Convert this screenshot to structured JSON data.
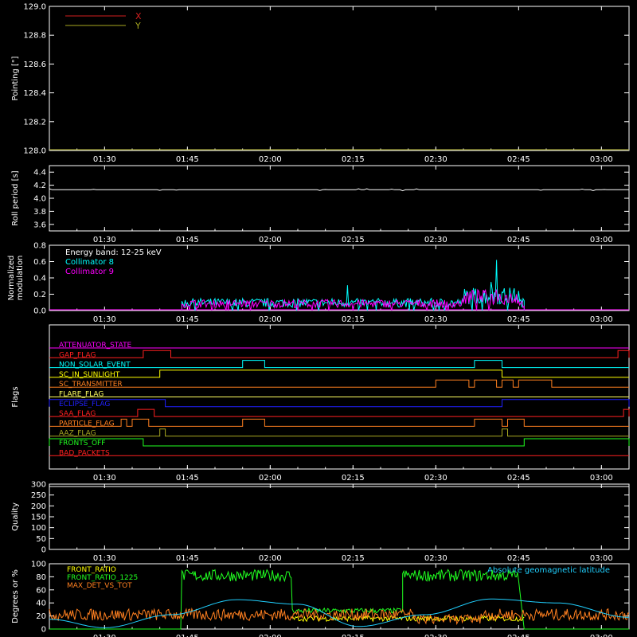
{
  "chart_data": [
    {
      "id": "pointing",
      "type": "line",
      "ylabel": "Pointing [\"]",
      "ylim": [
        128.0,
        129.0
      ],
      "yticks": [
        "128.0",
        "128.2",
        "128.4",
        "128.6",
        "128.8",
        "129.0"
      ],
      "xticks": [
        "01:30",
        "01:45",
        "02:00",
        "02:15",
        "02:30",
        "02:45",
        "03:00"
      ],
      "legend": [
        {
          "name": "X",
          "color": "#d42020"
        },
        {
          "name": "Y",
          "color": "#a8a820"
        }
      ],
      "series": []
    },
    {
      "id": "roll",
      "type": "line",
      "ylabel": "Roll period [s]",
      "ylim": [
        3.5,
        4.5
      ],
      "yticks": [
        "3.6",
        "3.8",
        "4.0",
        "4.2",
        "4.4"
      ],
      "xticks": [
        "01:30",
        "01:45",
        "02:00",
        "02:15",
        "02:30",
        "02:45",
        "03:00"
      ],
      "series": [
        {
          "color": "#ffffff",
          "x_range": [
            "01:20",
            "03:05"
          ],
          "value": 4.13
        }
      ]
    },
    {
      "id": "modulation",
      "type": "line",
      "ylabel": "Normalized modulation",
      "ylim": [
        0.0,
        0.8
      ],
      "yticks": [
        "0.0",
        "0.2",
        "0.4",
        "0.6",
        "0.8"
      ],
      "xticks": [
        "01:30",
        "01:45",
        "02:00",
        "02:15",
        "02:30",
        "02:45",
        "03:00"
      ],
      "annotations": [
        {
          "text": "Energy band: 12-25 keV",
          "color": "#ffffff"
        },
        {
          "text": "Collimator 8",
          "color": "#00ffff"
        },
        {
          "text": "Collimator 9",
          "color": "#ff00ff"
        }
      ],
      "series": [
        {
          "name": "Collimator 8",
          "color": "#00ffff",
          "x_range": [
            "01:44",
            "02:46"
          ],
          "typical": 0.1,
          "peaks": [
            [
              "02:14",
              0.31
            ],
            [
              "02:41",
              0.62
            ],
            [
              "02:40",
              0.35
            ]
          ]
        },
        {
          "name": "Collimator 9",
          "color": "#ff00ff",
          "x_range": [
            "01:44",
            "02:46"
          ],
          "typical": 0.09,
          "peaks": [
            [
              "02:41",
              0.25
            ]
          ]
        }
      ]
    },
    {
      "id": "flags",
      "type": "line",
      "ylabel": "Flags",
      "xticks": [
        "01:30",
        "01:45",
        "02:00",
        "02:15",
        "02:30",
        "02:45",
        "03:00"
      ],
      "flags": [
        {
          "name": "ATTENUATOR_STATE",
          "color": "#ff00ff",
          "segments": []
        },
        {
          "name": "GAP_FLAG",
          "color": "#ff2020",
          "segments": [
            [
              "01:37",
              "01:42"
            ],
            [
              "03:03",
              "03:05"
            ]
          ]
        },
        {
          "name": "NON_SOLAR_EVENT",
          "color": "#00ffff",
          "segments": [
            [
              "01:55",
              "01:59"
            ],
            [
              "02:37",
              "02:42"
            ]
          ]
        },
        {
          "name": "SC_IN_SUNLIGHT",
          "color": "#ffff00",
          "segments": [
            [
              "01:40",
              "02:42"
            ]
          ]
        },
        {
          "name": "SC_TRANSMITTER",
          "color": "#ff8020",
          "segments": [
            [
              "02:30",
              "02:36"
            ],
            [
              "02:37",
              "02:41"
            ],
            [
              "02:42",
              "02:44"
            ],
            [
              "02:45",
              "02:51"
            ]
          ]
        },
        {
          "name": "FLARE_FLAG",
          "color": "#ffff60",
          "segments": []
        },
        {
          "name": "ECLIPSE_FLAG",
          "color": "#2020ff",
          "segments": [
            [
              "01:20",
              "01:41"
            ],
            [
              "02:42",
              "03:05"
            ]
          ]
        },
        {
          "name": "SAA_FLAG",
          "color": "#ff2020",
          "segments": [
            [
              "01:36",
              "01:39"
            ],
            [
              "03:04",
              "03:05"
            ]
          ]
        },
        {
          "name": "PARTICLE_FLAG",
          "color": "#ff8020",
          "segments": [
            [
              "01:33",
              "01:34"
            ],
            [
              "01:35",
              "01:38"
            ],
            [
              "01:55",
              "01:59"
            ],
            [
              "02:37",
              "02:42"
            ],
            [
              "02:43",
              "02:46"
            ]
          ]
        },
        {
          "name": "AAZ_FLAG",
          "color": "#a8a820",
          "segments": [
            [
              "01:40",
              "01:41"
            ],
            [
              "02:42",
              "02:43"
            ]
          ]
        },
        {
          "name": "FRONTS_OFF",
          "color": "#20ff20",
          "segments": [
            [
              "01:20",
              "01:37"
            ],
            [
              "02:46",
              "03:05"
            ]
          ]
        },
        {
          "name": "BAD_PACKETS",
          "color": "#ff2020",
          "segments": []
        }
      ]
    },
    {
      "id": "quality",
      "type": "line",
      "ylabel": "Quality",
      "ylim": [
        0,
        300
      ],
      "yticks": [
        "0",
        "50",
        "100",
        "150",
        "200",
        "250",
        "300"
      ],
      "xticks": [
        "01:30",
        "01:45",
        "02:00",
        "02:15",
        "02:30",
        "02:45",
        "03:00"
      ],
      "series": []
    },
    {
      "id": "ratios",
      "type": "line",
      "ylabel": "Degrees or %",
      "ylim": [
        0,
        100
      ],
      "yticks": [
        "0",
        "20",
        "40",
        "60",
        "80",
        "100"
      ],
      "xticks": [
        "01:30",
        "01:45",
        "02:00",
        "02:15",
        "02:30",
        "02:45",
        "03:00"
      ],
      "legend": [
        {
          "name": "FRONT_RATIO",
          "color": "#ffff00"
        },
        {
          "name": "FRONT_RATIO_1225",
          "color": "#20ff20"
        },
        {
          "name": "MAX_DET_VS_TOT",
          "color": "#ff8020"
        }
      ],
      "annotation": {
        "text": "Absolute geomagnetic latitude",
        "color": "#20d0ff"
      },
      "series": [
        {
          "name": "FRONT_RATIO_1225",
          "color": "#20ff20",
          "segments": [
            {
              "range": [
                "01:20",
                "01:37"
              ],
              "value": 0
            },
            {
              "range": [
                "01:37",
                "01:44"
              ],
              "value": 0
            },
            {
              "range": [
                "01:44",
                "02:04"
              ],
              "value": 82
            },
            {
              "range": [
                "02:04",
                "02:24"
              ],
              "value": 28
            },
            {
              "range": [
                "02:24",
                "02:45"
              ],
              "value": 82
            },
            {
              "range": [
                "02:46",
                "03:05"
              ],
              "value": 0
            }
          ]
        },
        {
          "name": "FRONT_RATIO",
          "color": "#ffff00",
          "segments": [
            {
              "range": [
                "02:04",
                "02:46"
              ],
              "value": 16
            }
          ]
        },
        {
          "name": "MAX_DET_VS_TOT",
          "color": "#ff8020",
          "typical": 22
        },
        {
          "name": "Absolute geomagnetic latitude",
          "color": "#20d0ff",
          "x": [
            "01:20",
            "01:30",
            "01:42",
            "01:54",
            "02:05",
            "02:16",
            "02:28",
            "02:40",
            "02:52",
            "03:05"
          ],
          "values": [
            15,
            2,
            22,
            45,
            38,
            4,
            22,
            46,
            40,
            18
          ]
        }
      ]
    }
  ]
}
